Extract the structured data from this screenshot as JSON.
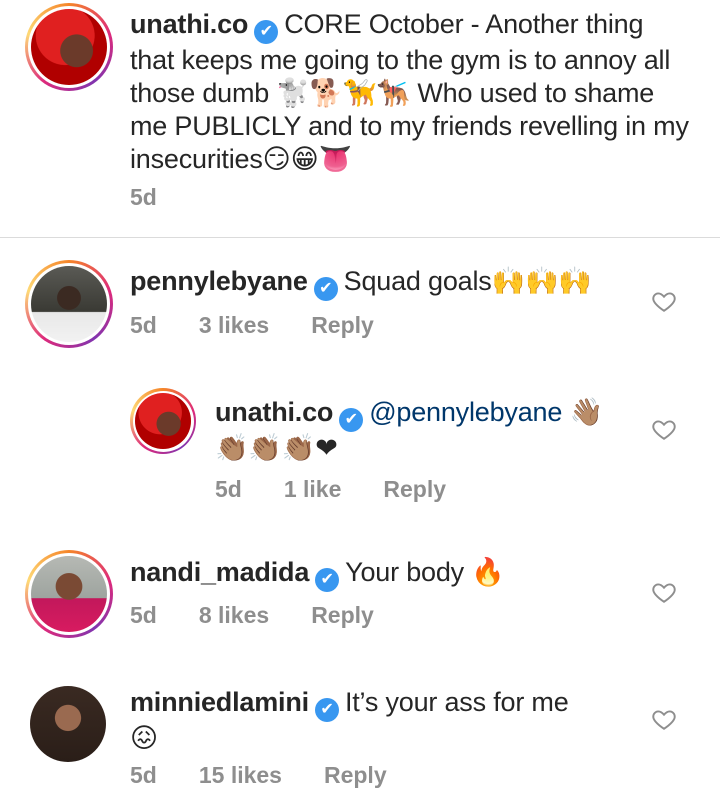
{
  "caption": {
    "username": "unathi.co",
    "text": "CORE October - Another thing that keeps me going to the gym is to annoy all those dumb 🐩🐕🦮🐕‍🦺 Who used to shame me PUBLICLY and to my friends revelling in my insecurities😏😁👅",
    "time": "5d"
  },
  "comments": [
    {
      "username": "pennylebyane",
      "text": "Squad goals🙌🙌🙌",
      "time": "5d",
      "likes": "3 likes",
      "reply": "Reply"
    },
    {
      "username": "unathi.co",
      "mention": "@pennylebyane",
      "text": "👋🏽👏🏽👏🏽👏🏽❤",
      "time": "5d",
      "likes": "1 like",
      "reply": "Reply"
    },
    {
      "username": "nandi_madida",
      "text": "Your body 🔥",
      "time": "5d",
      "likes": "8 likes",
      "reply": "Reply"
    },
    {
      "username": "minniedlamini",
      "text": "It’s your ass for me",
      "text2": "😖",
      "time": "5d",
      "likes": "15 likes",
      "reply": "Reply"
    }
  ],
  "icons": {
    "verified": "✔",
    "heart": "heart-outline-icon"
  },
  "colors": {
    "verified": "#3897f0",
    "meta": "#8e8e8e",
    "mention": "#00376b"
  }
}
